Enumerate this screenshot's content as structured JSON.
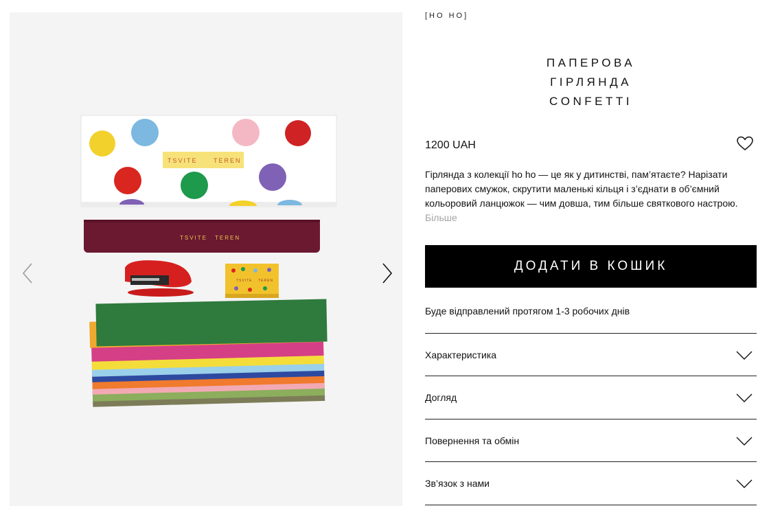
{
  "brand": "[HO HO]",
  "product": {
    "title_lines": [
      "ПАПЕРОВА",
      "ГІРЛЯНДА",
      "CONFETTI"
    ],
    "price": "1200 UAH",
    "description": "Гірлянда з колекції ho ho — це як у дитинстві, пам’ятаєте? Нарізати паперових смужок, скрутити маленькі кільця і з’єднати в об’ємний кольоровий ланцюжок — чим довша, тим більше святкового настрою.",
    "more_label": "Більше",
    "add_to_cart": "ДОДАТИ В КОШИК",
    "shipping_note": "Буде відправлений протягом 1-3 робочих днів"
  },
  "photo_text": {
    "box_label_left": "TSVITE",
    "box_label_right": "TEREN",
    "ribbon_left": "TSVITE",
    "ribbon_right": "TEREN",
    "matchbox_left": "TSVITE",
    "matchbox_right": "TEREN"
  },
  "accordion": [
    {
      "label": "Характеристика"
    },
    {
      "label": "Догляд"
    },
    {
      "label": "Повернення та обмін"
    },
    {
      "label": "Зв’язок з нами"
    }
  ],
  "icons": {
    "prev": "chevron-left-icon",
    "next": "chevron-right-icon",
    "wishlist": "heart-icon",
    "expand": "chevron-down-icon"
  },
  "colors": {
    "cart_background": "#000000",
    "gallery_background": "#f4f4f4",
    "more_link": "#a3a3a3"
  }
}
